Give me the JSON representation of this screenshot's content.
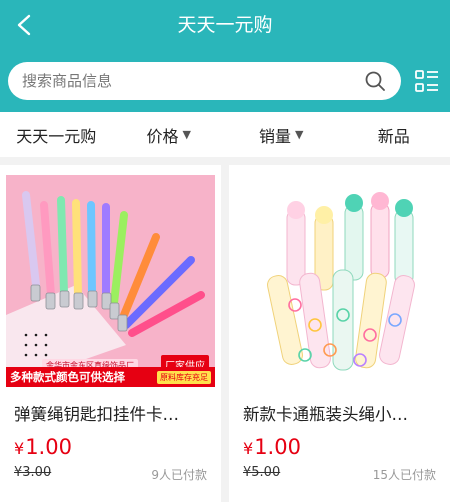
{
  "header": {
    "title": "天天一元购",
    "back_icon": "chevron-left-icon",
    "accent_color": "#2ab6ba"
  },
  "search": {
    "placeholder": "搜索商品信息",
    "icon": "search-icon"
  },
  "layout_toggle_icon": "list-layout-icon",
  "filters": [
    {
      "label": "天天一元购"
    },
    {
      "label": "价格",
      "arrow": "▼"
    },
    {
      "label": "销量",
      "arrow": "▼"
    },
    {
      "label": "新品"
    }
  ],
  "products": [
    {
      "name": "弹簧绳钥匙扣挂件卡…",
      "price_symbol": "¥",
      "price": "1.00",
      "orig_price": "¥3.00",
      "sales": "9人已付款",
      "banner_top": "金华市金东区真缘饰品厂",
      "banner_tag": "厂家供应",
      "banner_main": "多种款式颜色可供选择",
      "banner_sub": "原料库存充足"
    },
    {
      "name": "新款卡通瓶装头绳小…",
      "price_symbol": "¥",
      "price": "1.00",
      "orig_price": "¥5.00",
      "sales": "15人已付款"
    }
  ],
  "colors": {
    "price": "#e60012",
    "banner_red": "#e60012"
  }
}
